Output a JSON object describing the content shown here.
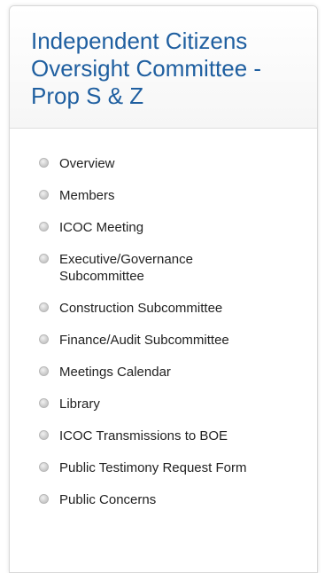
{
  "panel": {
    "title": "Independent Citizens Oversight Committee - Prop S & Z",
    "nav_items": [
      {
        "label": "Overview",
        "icon": "bullet-icon"
      },
      {
        "label": "Members",
        "icon": "bullet-icon"
      },
      {
        "label": "ICOC Meeting",
        "icon": "bullet-icon"
      },
      {
        "label": "Executive/Governance Subcommittee",
        "icon": "bullet-icon"
      },
      {
        "label": "Construction Subcommittee",
        "icon": "bullet-icon"
      },
      {
        "label": "Finance/Audit Subcommittee",
        "icon": "bullet-icon"
      },
      {
        "label": "Meetings Calendar",
        "icon": "bullet-icon"
      },
      {
        "label": "Library",
        "icon": "bullet-icon"
      },
      {
        "label": "ICOC Transmissions to BOE",
        "icon": "bullet-icon"
      },
      {
        "label": "Public Testimony Request Form",
        "icon": "bullet-icon"
      },
      {
        "label": "Public Concerns",
        "icon": "bullet-icon"
      }
    ]
  },
  "colors": {
    "title": "#1f5fa0",
    "text": "#222222",
    "border": "#d9d9d9"
  }
}
